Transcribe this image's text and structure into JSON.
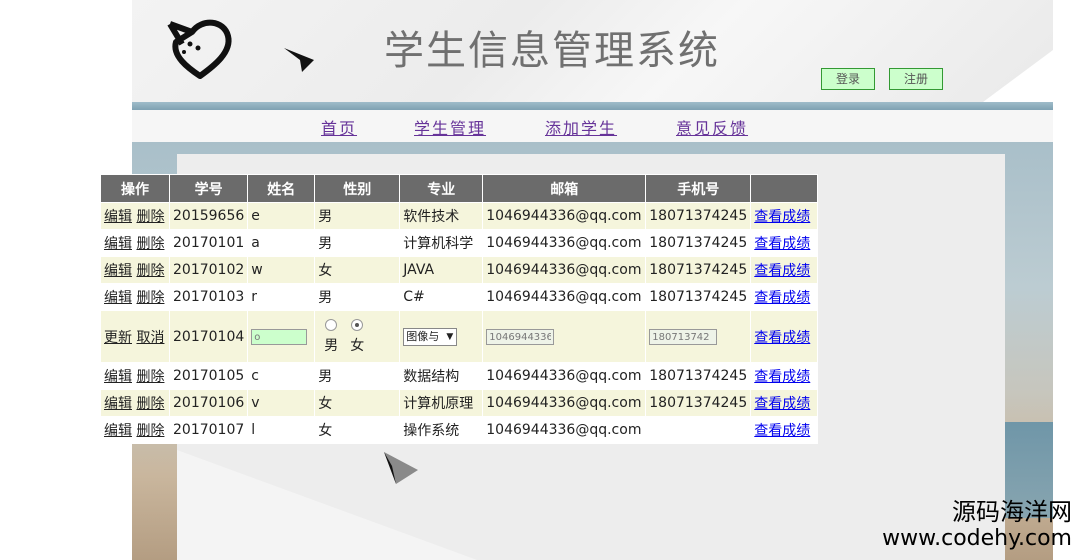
{
  "header": {
    "title": "学生信息管理系统",
    "login_label": "登录",
    "register_label": "注册"
  },
  "nav": {
    "items": [
      {
        "label": "首页"
      },
      {
        "label": "学生管理"
      },
      {
        "label": "添加学生"
      },
      {
        "label": "意见反馈"
      }
    ]
  },
  "table": {
    "columns": [
      "操作",
      "学号",
      "姓名",
      "性别",
      "专业",
      "邮箱",
      "手机号",
      ""
    ],
    "edit_label": "编辑",
    "delete_label": "删除",
    "update_label": "更新",
    "cancel_label": "取消",
    "score_label": "查看成绩",
    "rows": [
      {
        "id": "20159656",
        "name": "e",
        "gender": "男",
        "major": "软件技术",
        "email": "1046944336@qq.com",
        "phone": "18071374245"
      },
      {
        "id": "20170101",
        "name": "a",
        "gender": "男",
        "major": "计算机科学",
        "email": "1046944336@qq.com",
        "phone": "18071374245"
      },
      {
        "id": "20170102",
        "name": "w",
        "gender": "女",
        "major": "JAVA",
        "email": "1046944336@qq.com",
        "phone": "18071374245"
      },
      {
        "id": "20170103",
        "name": "r",
        "gender": "男",
        "major": "C#",
        "email": "1046944336@qq.com",
        "phone": "18071374245"
      },
      {
        "id": "20170105",
        "name": "c",
        "gender": "男",
        "major": "数据结构",
        "email": "1046944336@qq.com",
        "phone": "18071374245"
      },
      {
        "id": "20170106",
        "name": "v",
        "gender": "女",
        "major": "计算机原理",
        "email": "1046944336@qq.com",
        "phone": "18071374245"
      },
      {
        "id": "20170107",
        "name": "l",
        "gender": "女",
        "major": "操作系统",
        "email": "1046944336@qq.com",
        "phone": ""
      }
    ],
    "edit_row": {
      "id": "20170104",
      "name_value": "o",
      "gender_male": "男",
      "gender_female": "女",
      "gender_selected": "女",
      "major_value": "图像与",
      "email_value": "1046944336",
      "phone_value": "180713742"
    }
  },
  "watermark": {
    "line1": "源码海洋网",
    "line2": "www.codehy.com"
  },
  "colors": {
    "header_bar": "#6b6b6b",
    "row_odd": "#f5f5dc",
    "button_bg": "#ccffcc",
    "nav_link": "#663399",
    "score_link": "#0000ee"
  }
}
